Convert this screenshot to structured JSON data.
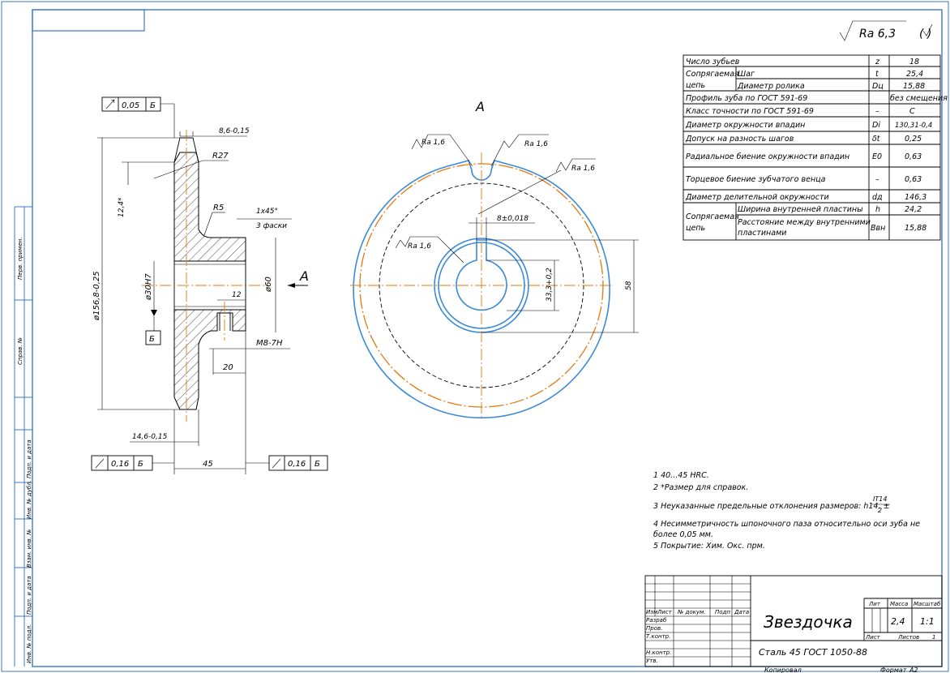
{
  "title_block": {
    "name": "Звездочка",
    "material": "Сталь 45 ГОСТ 1050-88",
    "lit_header": "Лит",
    "mass_header": "Масса",
    "scale_header": "Масштаб",
    "mass": "2,4",
    "scale": "1:1",
    "sheet_label": "Лист",
    "sheets_label": "Листов",
    "sheets_count": "1",
    "copied": "Копировал",
    "format": "Формат",
    "format_value": "А2",
    "rows": [
      "Изм",
      "Лист",
      "№ докум.",
      "Подп",
      "Дата"
    ],
    "roles": [
      "Разраб",
      "Пров.",
      "Т.контр.",
      "",
      "Н.контр.",
      "Утв."
    ]
  },
  "side_strip": [
    "Перв. примен.",
    "Справ. №",
    "Подп. и дата",
    "Инв. № дубл.",
    "Взам. инв. №",
    "Подп. и дата",
    "Инв. № подл."
  ],
  "roughness": {
    "general": "Ra 6,3",
    "general_paren": "( )"
  },
  "params_table": [
    {
      "group": "Число зубьев",
      "sym": "z",
      "val": "18"
    },
    {
      "group": "Сопрягаемая цепь",
      "param": "Шаг",
      "sym": "t",
      "val": "25,4"
    },
    {
      "param": "Диаметр ролика",
      "sym": "Dц",
      "val": "15,88"
    },
    {
      "group": "Профиль зуба по ГОСТ 591-69",
      "val": "без смещения"
    },
    {
      "group": "Класс точности по ГОСТ 591-69",
      "sym": "–",
      "val": "С"
    },
    {
      "group": "Диаметр окружности впадин",
      "sym": "Di",
      "val": "130,31-0,4"
    },
    {
      "group": "Допуск на разность шагов",
      "sym": "δt",
      "val": "0,25"
    },
    {
      "group": "Радиальное биение окружности впадин",
      "sym": "E0",
      "val": "0,63"
    },
    {
      "group": "Торцевое биение зубчатого венца",
      "sym": "–",
      "val": "0,63"
    },
    {
      "group": "Диаметр делительной окружности",
      "sym": "dд",
      "val": "146,3"
    },
    {
      "group": "Сопрягаемая цепь",
      "param": "Ширина внутренней пластины",
      "sym": "h",
      "val": "24,2"
    },
    {
      "param": "Расстояние между внутренними пластинами",
      "sym": "Bвн",
      "val": "15,88"
    }
  ],
  "notes": [
    "1 40...45 HRC.",
    "2 *Размер для справок.",
    "3 Неуказанные предельные отклонения размеров: h14, ±",
    "4 Несимметричность шпоночного паза относительно оси зуба не более 0,05 мм.",
    "5 Покрытие: Хим. Окс. прм."
  ],
  "note3_frac": {
    "num": "IT14",
    "den": "2"
  },
  "section_view": {
    "view_letter": "А",
    "tol_top": {
      "value": "0,05",
      "datum": "Б"
    },
    "tol_bottom_left": {
      "value": "0,16",
      "datum": "Б"
    },
    "tol_bottom_right": {
      "value": "0,16",
      "datum": "Б"
    },
    "dim_width_top": "8,6-0,15",
    "radius_r27": "R27",
    "dim_124": "12,4*",
    "radius_r5": "R5",
    "chamfer": "1x45°",
    "chamfer_note": "3 фаски",
    "dia_outer": "ø156,8-0,25",
    "dia_bore": "ø30Н7",
    "dia_hub": "ø60",
    "dim_12": "12",
    "thread": "М8-7Н",
    "dim_20": "20",
    "dim_146": "14,6-0,15",
    "dim_45": "45",
    "datum_b": "Б"
  },
  "front_view": {
    "title": "А",
    "ra_top_left": "Ra 1,6",
    "ra_top_right": "Ra 1,6",
    "ra_key": "Ra 1,6",
    "ra_bore": "Ra 1,6",
    "key_width": "8±0,018",
    "dim_333": "33,3+0,2",
    "dim_58": "58"
  },
  "colors": {
    "frame": "#3a78c8",
    "outline": "#3a8ad8",
    "axis": "#e07a10"
  }
}
